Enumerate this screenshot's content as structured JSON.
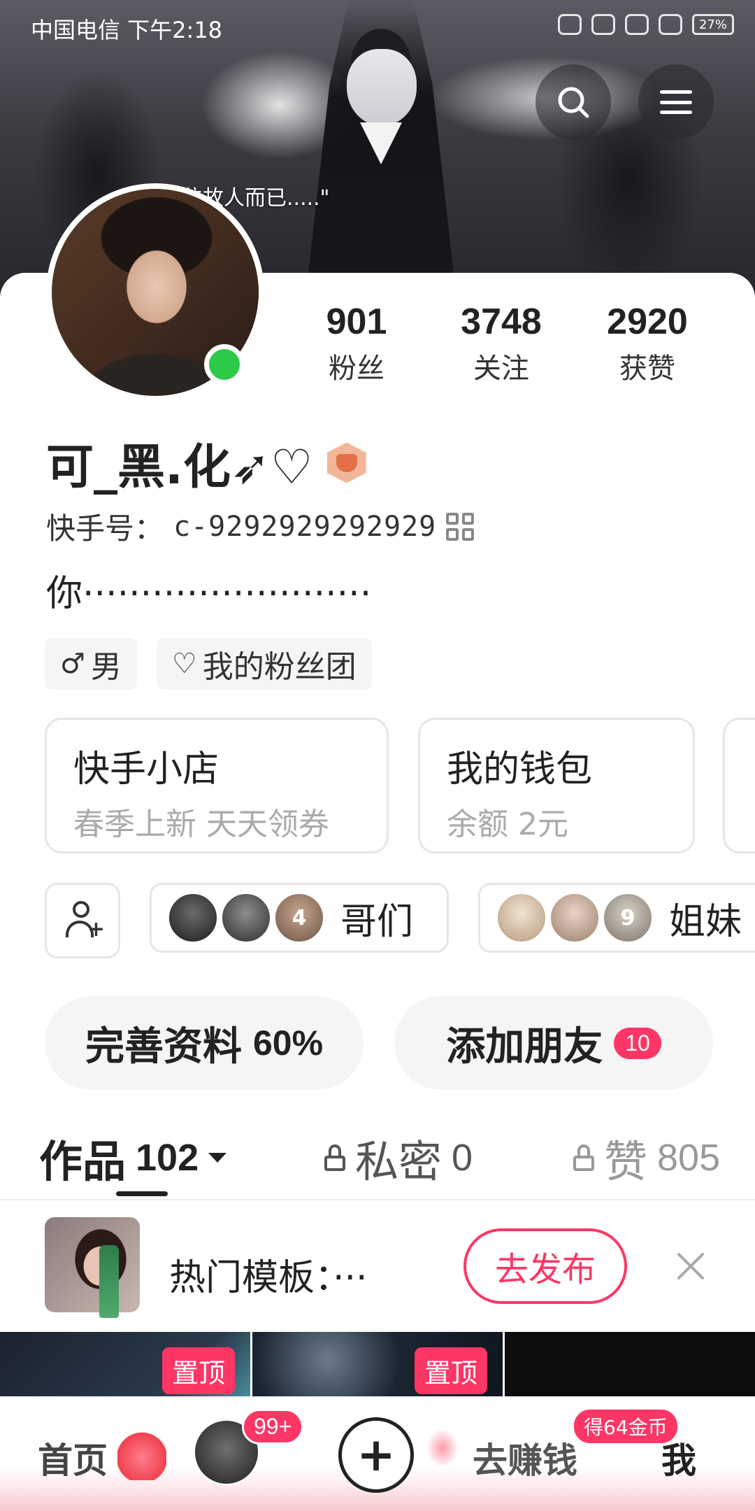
{
  "status_bar": {
    "carrier_time": "中国电信 下午2:18",
    "battery": "27%"
  },
  "banner": {
    "quote": "一位故人而已.....\""
  },
  "profile": {
    "stats": [
      {
        "value": "901",
        "label": "粉丝"
      },
      {
        "value": "3748",
        "label": "关注"
      },
      {
        "value": "2920",
        "label": "获赞"
      }
    ],
    "nickname": "可_黑.化➶♡",
    "kwai_id_label": "快手号：",
    "kwai_id": "c-9292929292929",
    "bio": "你·························",
    "tags": [
      {
        "icon": "male-icon",
        "symbol": "♂",
        "label": "男"
      },
      {
        "icon": "heart-icon",
        "symbol": "♡",
        "label": "我的粉丝团"
      }
    ]
  },
  "services": [
    {
      "title": "快手小店",
      "subtitle": "春季上新 天天领券"
    },
    {
      "title": "我的钱包",
      "subtitle": "余额 2元"
    },
    {
      "title": "",
      "subtitle": ""
    }
  ],
  "groups": [
    {
      "name": "哥们",
      "overlay_count": "4"
    },
    {
      "name": "姐妹",
      "overlay_count": "9"
    }
  ],
  "actions": {
    "complete_profile_label": "完善资料",
    "complete_profile_pct": "60%",
    "add_friends_label": "添加朋友",
    "add_friends_badge": "10"
  },
  "tabs": [
    {
      "label": "作品",
      "count": "102"
    },
    {
      "label": "私密",
      "count": "0"
    },
    {
      "label": "赞",
      "count": "805"
    }
  ],
  "template_bar": {
    "text": "热门模板：···",
    "button": "去发布"
  },
  "videos": [
    {
      "pin_label": "置顶"
    },
    {
      "pin_label": "置顶"
    },
    {
      "pin_label": ""
    }
  ],
  "bottom_nav": {
    "home": "首页",
    "feed_badge": "99+",
    "add_symbol": "+",
    "earn": "去赚钱",
    "earn_badge": "得64金币",
    "me": "我"
  },
  "colors": {
    "accent": "#fe3666",
    "online": "#2fc94a"
  }
}
